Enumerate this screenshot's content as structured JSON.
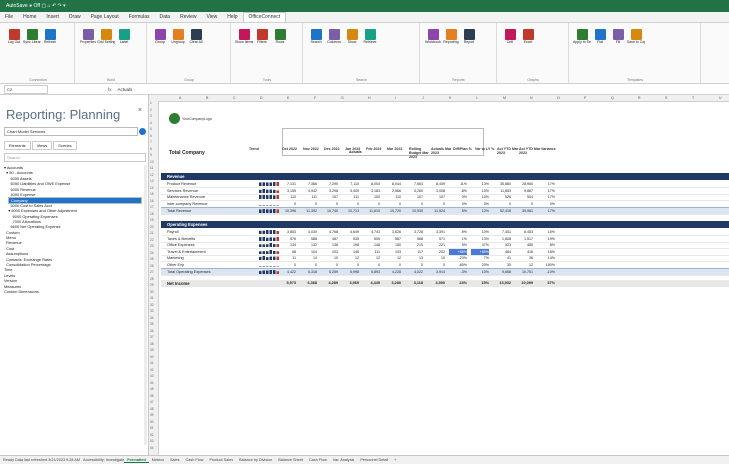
{
  "window": {
    "title": "AutoSave  ●  Off  ▢  ⌂  ↶  ↷  ▾"
  },
  "tabs": [
    "File",
    "Home",
    "Insert",
    "Draw",
    "Page Layout",
    "Formulas",
    "Data",
    "Review",
    "View",
    "Help",
    "OfficeConnect"
  ],
  "active_tab": "OfficeConnect",
  "ribbon_groups": [
    {
      "label": "Connection",
      "buttons": [
        "Log Out",
        "Sync Library",
        "Refresh"
      ]
    },
    {
      "label": "Build",
      "buttons": [
        "Properties",
        "Grid Settings",
        "Label"
      ]
    },
    {
      "label": "Group",
      "buttons": [
        "Group",
        "Ungroup",
        "Clear All"
      ]
    },
    {
      "label": "Tools",
      "buttons": [
        "Show Items",
        "Filters",
        "Rows"
      ]
    },
    {
      "label": "Search",
      "buttons": [
        "Search",
        "Columns",
        "Show",
        "Retrieve"
      ]
    },
    {
      "label": "Reports",
      "buttons": [
        "Workbook",
        "Reporting",
        "Report"
      ]
    },
    {
      "label": "Graphs",
      "buttons": [
        "Drill",
        "Excel"
      ]
    },
    {
      "label": "Templates",
      "buttons": [
        "Apply to Selection",
        "Flat",
        "Fill",
        "Save to Copy Report"
      ]
    }
  ],
  "formula_bar": {
    "name_box": "C2",
    "fx": "fx",
    "value": "Actuals"
  },
  "panel": {
    "title": "Reporting: Planning",
    "close": "×",
    "select": "Chart Model Services",
    "tabs": [
      "Elements",
      "Views",
      "Scenes"
    ],
    "search": "Search",
    "tree": [
      "▾ Accounts",
      "  ▾ 50 - Accounts",
      "      6000 Assets",
      "      6050 Liabilities and OWE Expense",
      "      5000 Revenue",
      "      4000 Expense",
      "      3100 Net Operating Income",
      "      5000 Cost to Sales Acct",
      "    ▾ 6000 Expenses and Other Adjustment",
      "        6000 Operating Expenses",
      "        7000 Allocations",
      "      6600 Net Operating Expense",
      "  Custom",
      "  Menu",
      "  Revenue",
      "  Cost",
      "  Assumptions",
      "  Contacts: Exchange Rates",
      "  Consolidation Percentage",
      "Time",
      "Levels",
      "Version",
      "Company",
      "Measures",
      "Custom Dimensions"
    ],
    "selected": "Company"
  },
  "sheet": {
    "logo_text": "YourCompanyLogo",
    "company": "Total Company",
    "actuals_label": "Actuals",
    "col_letters": [
      "A",
      "B",
      "C",
      "D",
      "E",
      "F",
      "G",
      "H",
      "I",
      "J",
      "K",
      "L",
      "M",
      "N",
      "O",
      "P",
      "Q",
      "R",
      "S",
      "T",
      "U"
    ],
    "headers": [
      "Trend",
      "Oct 2022",
      "Nov 2022",
      "Dec 2022",
      "Jan 2023",
      "Feb 2023",
      "Mar 2023",
      "Rolling Budget Mar 2023",
      "Actuals Mar 2023",
      "Diff/Plan %",
      "Var to LY %",
      "Act YTD Mar 2023",
      "Act YTD Mar 2022",
      "Variance"
    ],
    "revenue_title": "Revenue",
    "revenue": [
      {
        "label": "Product Revenue",
        "values": [
          "7,131",
          "7,366",
          "7,290",
          "7,110",
          "8,004",
          "8,044",
          "7,563",
          "8,409",
          "11%",
          "13%",
          "35,860",
          "28,960",
          "17%"
        ]
      },
      {
        "label": "Services Revenue",
        "values": [
          "3,155",
          "3,942",
          "3,298",
          "3,409",
          "3,183",
          "2,566",
          "3,260",
          "3,008",
          "-8%",
          "10%",
          "11,853",
          "9,867",
          "17%"
        ]
      },
      {
        "label": "Maintenance Revenue",
        "values": [
          "110",
          "111",
          "107",
          "111",
          "100",
          "110",
          "107",
          "107",
          "0%",
          "10%",
          "526",
          "504",
          "17%"
        ]
      },
      {
        "label": "Inter-company Revenue",
        "values": [
          "0",
          "0",
          "0",
          "0",
          "0",
          "0",
          "0",
          "0",
          "0%",
          "0%",
          "0",
          "0",
          "0%"
        ]
      }
    ],
    "revenue_total": {
      "label": "Total Revenue",
      "values": [
        "10,396",
        "11,392",
        "10,740",
        "10,713",
        "11,610",
        "10,720",
        "10,930",
        "11,524",
        "5%",
        "12%",
        "52,418",
        "39,961",
        "17%"
      ]
    },
    "opex_title": "Operating Expenses",
    "opex": [
      {
        "label": "Payroll",
        "values": [
          "3,853",
          "4,030",
          "4,768",
          "4,649",
          "4,743",
          "3,626",
          "3,728",
          "3,391",
          "-9%",
          "10%",
          "7,451",
          "6,453",
          "15%"
        ]
      },
      {
        "label": "Taxes & Benefits",
        "values": [
          "576",
          "588",
          "487",
          "535",
          "505",
          "587",
          "568",
          "571",
          "1%",
          "13%",
          "1,808",
          "1,517",
          "19%"
        ]
      },
      {
        "label": "Office Expenses",
        "values": [
          "134",
          "132",
          "136",
          "198",
          "148",
          "150",
          "210",
          "221",
          "5%",
          "47%",
          "523",
          "485",
          "8%"
        ]
      },
      {
        "label": "Travel & Entertainment",
        "values": [
          "98",
          "104",
          "103",
          "146",
          "111",
          "103",
          "117",
          "202",
          "+85%",
          "+85%",
          "484",
          "416",
          "16%"
        ]
      },
      {
        "label": "Marketing",
        "values": [
          "11",
          "14",
          "10",
          "12",
          "12",
          "12",
          "13",
          "10",
          "-23%",
          "7%",
          "41",
          "36",
          "14%"
        ]
      },
      {
        "label": "Other Exp",
        "values": [
          "0",
          "0",
          "0",
          "0",
          "0",
          "0",
          "0",
          "0",
          "-80%",
          "20%",
          "30",
          "12",
          "150%"
        ]
      }
    ],
    "opex_total": {
      "label": "Total Operating Expenses",
      "values": [
        "4,422",
        "5,318",
        "5,259",
        "5,998",
        "5,893",
        "4,228",
        "4,022",
        "3,914",
        "-3%",
        "10%",
        "9,668",
        "10,751",
        "-10%"
      ]
    },
    "net": {
      "label": "Net Income",
      "values": [
        "5,973",
        "6,368",
        "4,289",
        "3,969",
        "4,449",
        "3,280",
        "3,118",
        "4,900",
        "24%",
        "15%",
        "13,932",
        "10,099",
        "37%"
      ]
    }
  },
  "status": {
    "text": "Ready  Data last refreshed 3/21/2023 9:28 AM",
    "accessibility": "Accessibility: Investigate",
    "sheet_tabs": [
      "Formatted",
      "Metrics",
      "Sales",
      "Cash Flow",
      "Product Sales",
      "Balance by Division",
      "Balance Sheet",
      "Cash Flow",
      "Var. Analysis",
      "Personnel Detail",
      "+"
    ],
    "active_sheet": "Formatted"
  }
}
